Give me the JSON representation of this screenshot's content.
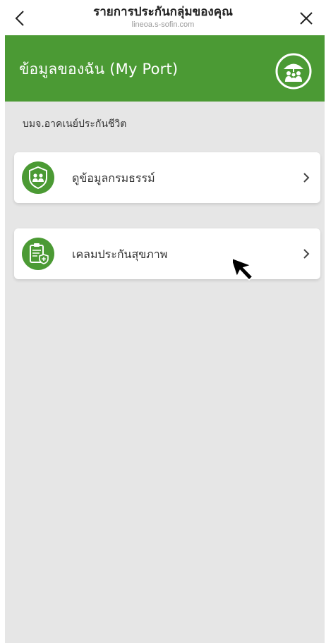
{
  "topbar": {
    "title": "รายการประกันกลุ่มของคุณ",
    "url": "lineoa.s-sofin.com",
    "back_icon": "chevron-left-icon",
    "close_icon": "close-icon"
  },
  "header": {
    "title": "ข้อมูลของฉัน (My Port)",
    "icon": "family-umbrella-icon",
    "color": "#4b9a34"
  },
  "company": "บมจ.อาคเนย์ประกันชีวิต",
  "cards": [
    {
      "label": "ดูข้อมูลกรมธรรม์",
      "icon": "policy-shield-icon"
    },
    {
      "label": "เคลมประกันสุขภาพ",
      "icon": "health-claim-icon"
    }
  ],
  "colors": {
    "accent": "#4b9a34",
    "background": "#e6e6e6",
    "card": "#ffffff"
  }
}
